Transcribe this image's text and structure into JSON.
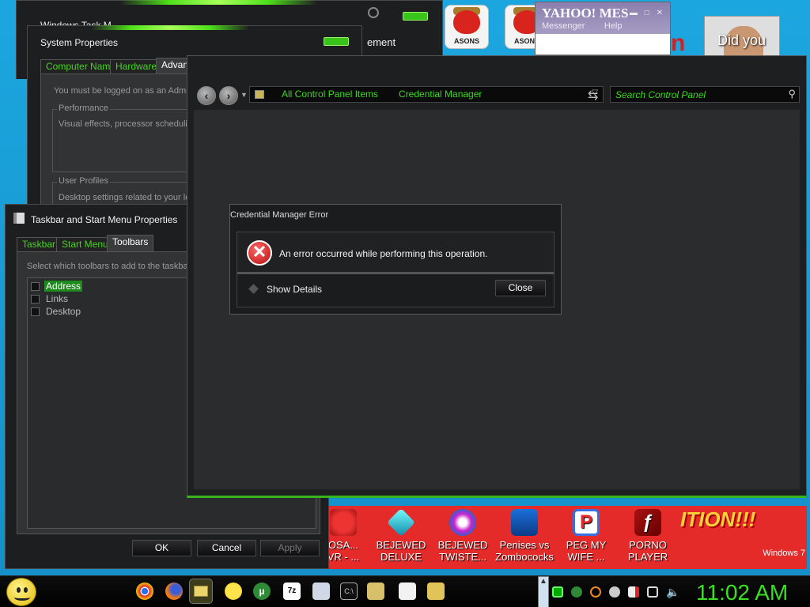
{
  "desktop": {
    "watermark": "Windows 7",
    "icons": [
      {
        "label": "OSA...\nVR - ..."
      },
      {
        "label": "BEJEWED\nDELUXE"
      },
      {
        "label": "BEJEWED\nTWISTE..."
      },
      {
        "label": "Penises vs\nZombococks"
      },
      {
        "label": "PEG MY\nWIFE ..."
      },
      {
        "label": "PORNO\nPLAYER"
      }
    ],
    "top_icons": [
      {
        "label": "ASONS"
      },
      {
        "label": "ASONS"
      }
    ],
    "banner_text": "ITION!!!",
    "yahoo": {
      "logo": "YAHOO! MES",
      "messenger": "Messenger",
      "help": "Help"
    },
    "did_you": "Did you"
  },
  "task_manager": {
    "title": "Windows Task M"
  },
  "system_properties": {
    "title": "System Properties",
    "tabs": [
      "Computer Name",
      "Hardware",
      "Advanc"
    ],
    "admin_text": "You must be logged on as an Admin",
    "performance_label": "Performance",
    "performance_text": "Visual effects, processor schedulin",
    "user_profiles_label": "User Profiles",
    "user_profiles_text": "Desktop settings related to your lo",
    "fragment": "ement"
  },
  "taskbar_props": {
    "title": "Taskbar and Start Menu Properties",
    "tabs": [
      "Taskbar",
      "Start Menu",
      "Toolbars"
    ],
    "instruction": "Select which toolbars to add to the taskba",
    "toolbars": [
      {
        "label": "Address",
        "checked": false,
        "selected": true
      },
      {
        "label": "Links",
        "checked": false,
        "selected": false
      },
      {
        "label": "Desktop",
        "checked": false,
        "selected": false
      }
    ],
    "ok": "OK",
    "cancel": "Cancel",
    "apply": "Apply"
  },
  "control_panel": {
    "breadcrumb": [
      "All Control Panel Items",
      "Credential Manager"
    ],
    "search_placeholder": "Search Control Panel"
  },
  "error_dialog": {
    "title": "Credential Manager Error",
    "message": "An error occurred while performing this operation.",
    "show_details": "Show Details",
    "close": "Close"
  },
  "taskbar": {
    "clock": "11:02 AM",
    "tray_arrow": "▲",
    "accent": "#39e01f"
  }
}
